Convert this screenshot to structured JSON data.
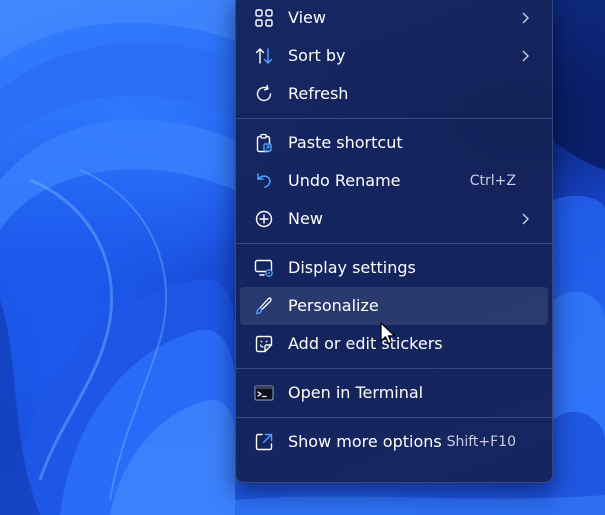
{
  "context_menu": {
    "groups": [
      [
        {
          "label": "View",
          "icon": "view-grid-icon",
          "submenu": true
        },
        {
          "label": "Sort by",
          "icon": "sort-icon",
          "submenu": true
        },
        {
          "label": "Refresh",
          "icon": "refresh-icon"
        }
      ],
      [
        {
          "label": "Paste shortcut",
          "icon": "paste-shortcut-icon"
        },
        {
          "label": "Undo Rename",
          "icon": "undo-icon",
          "shortcut": "Ctrl+Z"
        },
        {
          "label": "New",
          "icon": "plus-circle-icon",
          "submenu": true
        }
      ],
      [
        {
          "label": "Display settings",
          "icon": "display-settings-icon"
        },
        {
          "label": "Personalize",
          "icon": "brush-icon",
          "highlighted": true
        },
        {
          "label": "Add or edit stickers",
          "icon": "sticker-icon"
        }
      ],
      [
        {
          "label": "Open in Terminal",
          "icon": "terminal-icon"
        }
      ],
      [
        {
          "label": "Show more options",
          "icon": "show-more-options-icon",
          "shortcut": "Shift+F10"
        }
      ]
    ]
  },
  "colors": {
    "menu_background": "#142256",
    "text": "#ffffff",
    "shortcut_text": "#c9cfe0",
    "hover": "#2a3768",
    "wallpaper_blue": "#1d56e8"
  }
}
